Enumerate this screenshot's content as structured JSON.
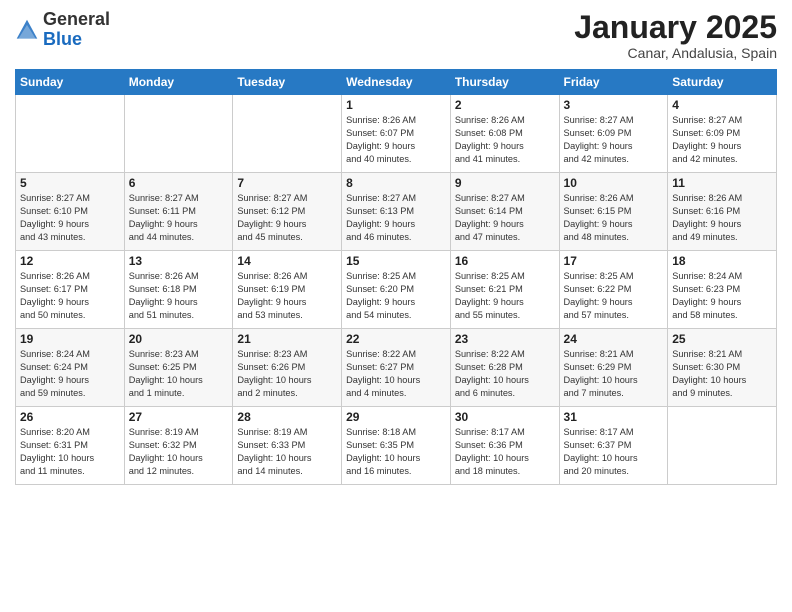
{
  "header": {
    "logo_general": "General",
    "logo_blue": "Blue",
    "month": "January 2025",
    "location": "Canar, Andalusia, Spain"
  },
  "weekdays": [
    "Sunday",
    "Monday",
    "Tuesday",
    "Wednesday",
    "Thursday",
    "Friday",
    "Saturday"
  ],
  "weeks": [
    [
      {
        "day": "",
        "info": ""
      },
      {
        "day": "",
        "info": ""
      },
      {
        "day": "",
        "info": ""
      },
      {
        "day": "1",
        "info": "Sunrise: 8:26 AM\nSunset: 6:07 PM\nDaylight: 9 hours\nand 40 minutes."
      },
      {
        "day": "2",
        "info": "Sunrise: 8:26 AM\nSunset: 6:08 PM\nDaylight: 9 hours\nand 41 minutes."
      },
      {
        "day": "3",
        "info": "Sunrise: 8:27 AM\nSunset: 6:09 PM\nDaylight: 9 hours\nand 42 minutes."
      },
      {
        "day": "4",
        "info": "Sunrise: 8:27 AM\nSunset: 6:09 PM\nDaylight: 9 hours\nand 42 minutes."
      }
    ],
    [
      {
        "day": "5",
        "info": "Sunrise: 8:27 AM\nSunset: 6:10 PM\nDaylight: 9 hours\nand 43 minutes."
      },
      {
        "day": "6",
        "info": "Sunrise: 8:27 AM\nSunset: 6:11 PM\nDaylight: 9 hours\nand 44 minutes."
      },
      {
        "day": "7",
        "info": "Sunrise: 8:27 AM\nSunset: 6:12 PM\nDaylight: 9 hours\nand 45 minutes."
      },
      {
        "day": "8",
        "info": "Sunrise: 8:27 AM\nSunset: 6:13 PM\nDaylight: 9 hours\nand 46 minutes."
      },
      {
        "day": "9",
        "info": "Sunrise: 8:27 AM\nSunset: 6:14 PM\nDaylight: 9 hours\nand 47 minutes."
      },
      {
        "day": "10",
        "info": "Sunrise: 8:26 AM\nSunset: 6:15 PM\nDaylight: 9 hours\nand 48 minutes."
      },
      {
        "day": "11",
        "info": "Sunrise: 8:26 AM\nSunset: 6:16 PM\nDaylight: 9 hours\nand 49 minutes."
      }
    ],
    [
      {
        "day": "12",
        "info": "Sunrise: 8:26 AM\nSunset: 6:17 PM\nDaylight: 9 hours\nand 50 minutes."
      },
      {
        "day": "13",
        "info": "Sunrise: 8:26 AM\nSunset: 6:18 PM\nDaylight: 9 hours\nand 51 minutes."
      },
      {
        "day": "14",
        "info": "Sunrise: 8:26 AM\nSunset: 6:19 PM\nDaylight: 9 hours\nand 53 minutes."
      },
      {
        "day": "15",
        "info": "Sunrise: 8:25 AM\nSunset: 6:20 PM\nDaylight: 9 hours\nand 54 minutes."
      },
      {
        "day": "16",
        "info": "Sunrise: 8:25 AM\nSunset: 6:21 PM\nDaylight: 9 hours\nand 55 minutes."
      },
      {
        "day": "17",
        "info": "Sunrise: 8:25 AM\nSunset: 6:22 PM\nDaylight: 9 hours\nand 57 minutes."
      },
      {
        "day": "18",
        "info": "Sunrise: 8:24 AM\nSunset: 6:23 PM\nDaylight: 9 hours\nand 58 minutes."
      }
    ],
    [
      {
        "day": "19",
        "info": "Sunrise: 8:24 AM\nSunset: 6:24 PM\nDaylight: 9 hours\nand 59 minutes."
      },
      {
        "day": "20",
        "info": "Sunrise: 8:23 AM\nSunset: 6:25 PM\nDaylight: 10 hours\nand 1 minute."
      },
      {
        "day": "21",
        "info": "Sunrise: 8:23 AM\nSunset: 6:26 PM\nDaylight: 10 hours\nand 2 minutes."
      },
      {
        "day": "22",
        "info": "Sunrise: 8:22 AM\nSunset: 6:27 PM\nDaylight: 10 hours\nand 4 minutes."
      },
      {
        "day": "23",
        "info": "Sunrise: 8:22 AM\nSunset: 6:28 PM\nDaylight: 10 hours\nand 6 minutes."
      },
      {
        "day": "24",
        "info": "Sunrise: 8:21 AM\nSunset: 6:29 PM\nDaylight: 10 hours\nand 7 minutes."
      },
      {
        "day": "25",
        "info": "Sunrise: 8:21 AM\nSunset: 6:30 PM\nDaylight: 10 hours\nand 9 minutes."
      }
    ],
    [
      {
        "day": "26",
        "info": "Sunrise: 8:20 AM\nSunset: 6:31 PM\nDaylight: 10 hours\nand 11 minutes."
      },
      {
        "day": "27",
        "info": "Sunrise: 8:19 AM\nSunset: 6:32 PM\nDaylight: 10 hours\nand 12 minutes."
      },
      {
        "day": "28",
        "info": "Sunrise: 8:19 AM\nSunset: 6:33 PM\nDaylight: 10 hours\nand 14 minutes."
      },
      {
        "day": "29",
        "info": "Sunrise: 8:18 AM\nSunset: 6:35 PM\nDaylight: 10 hours\nand 16 minutes."
      },
      {
        "day": "30",
        "info": "Sunrise: 8:17 AM\nSunset: 6:36 PM\nDaylight: 10 hours\nand 18 minutes."
      },
      {
        "day": "31",
        "info": "Sunrise: 8:17 AM\nSunset: 6:37 PM\nDaylight: 10 hours\nand 20 minutes."
      },
      {
        "day": "",
        "info": ""
      }
    ]
  ]
}
